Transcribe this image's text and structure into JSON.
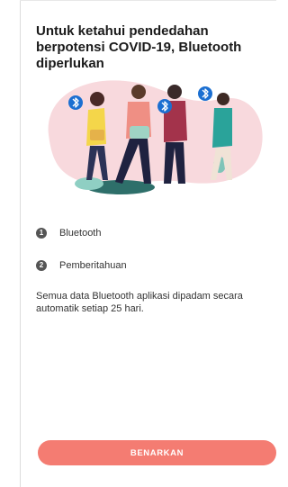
{
  "permission_screen": {
    "title": "Untuk ketahui pendedahan berpotensi COVID-19, Bluetooth diperlukan",
    "illustration_icon": "bluetooth-icon",
    "permissions": [
      {
        "number": "1",
        "label": "Bluetooth"
      },
      {
        "number": "2",
        "label": "Pemberitahuan"
      }
    ],
    "note": "Semua data Bluetooth aplikasi dipadam secara automatik setiap 25 hari.",
    "confirm_label": "BENARKAN"
  },
  "colors": {
    "accent": "#f47c72",
    "bluetooth_badge": "#1b6fd1",
    "illustration_bg": "#f8d9dd"
  }
}
